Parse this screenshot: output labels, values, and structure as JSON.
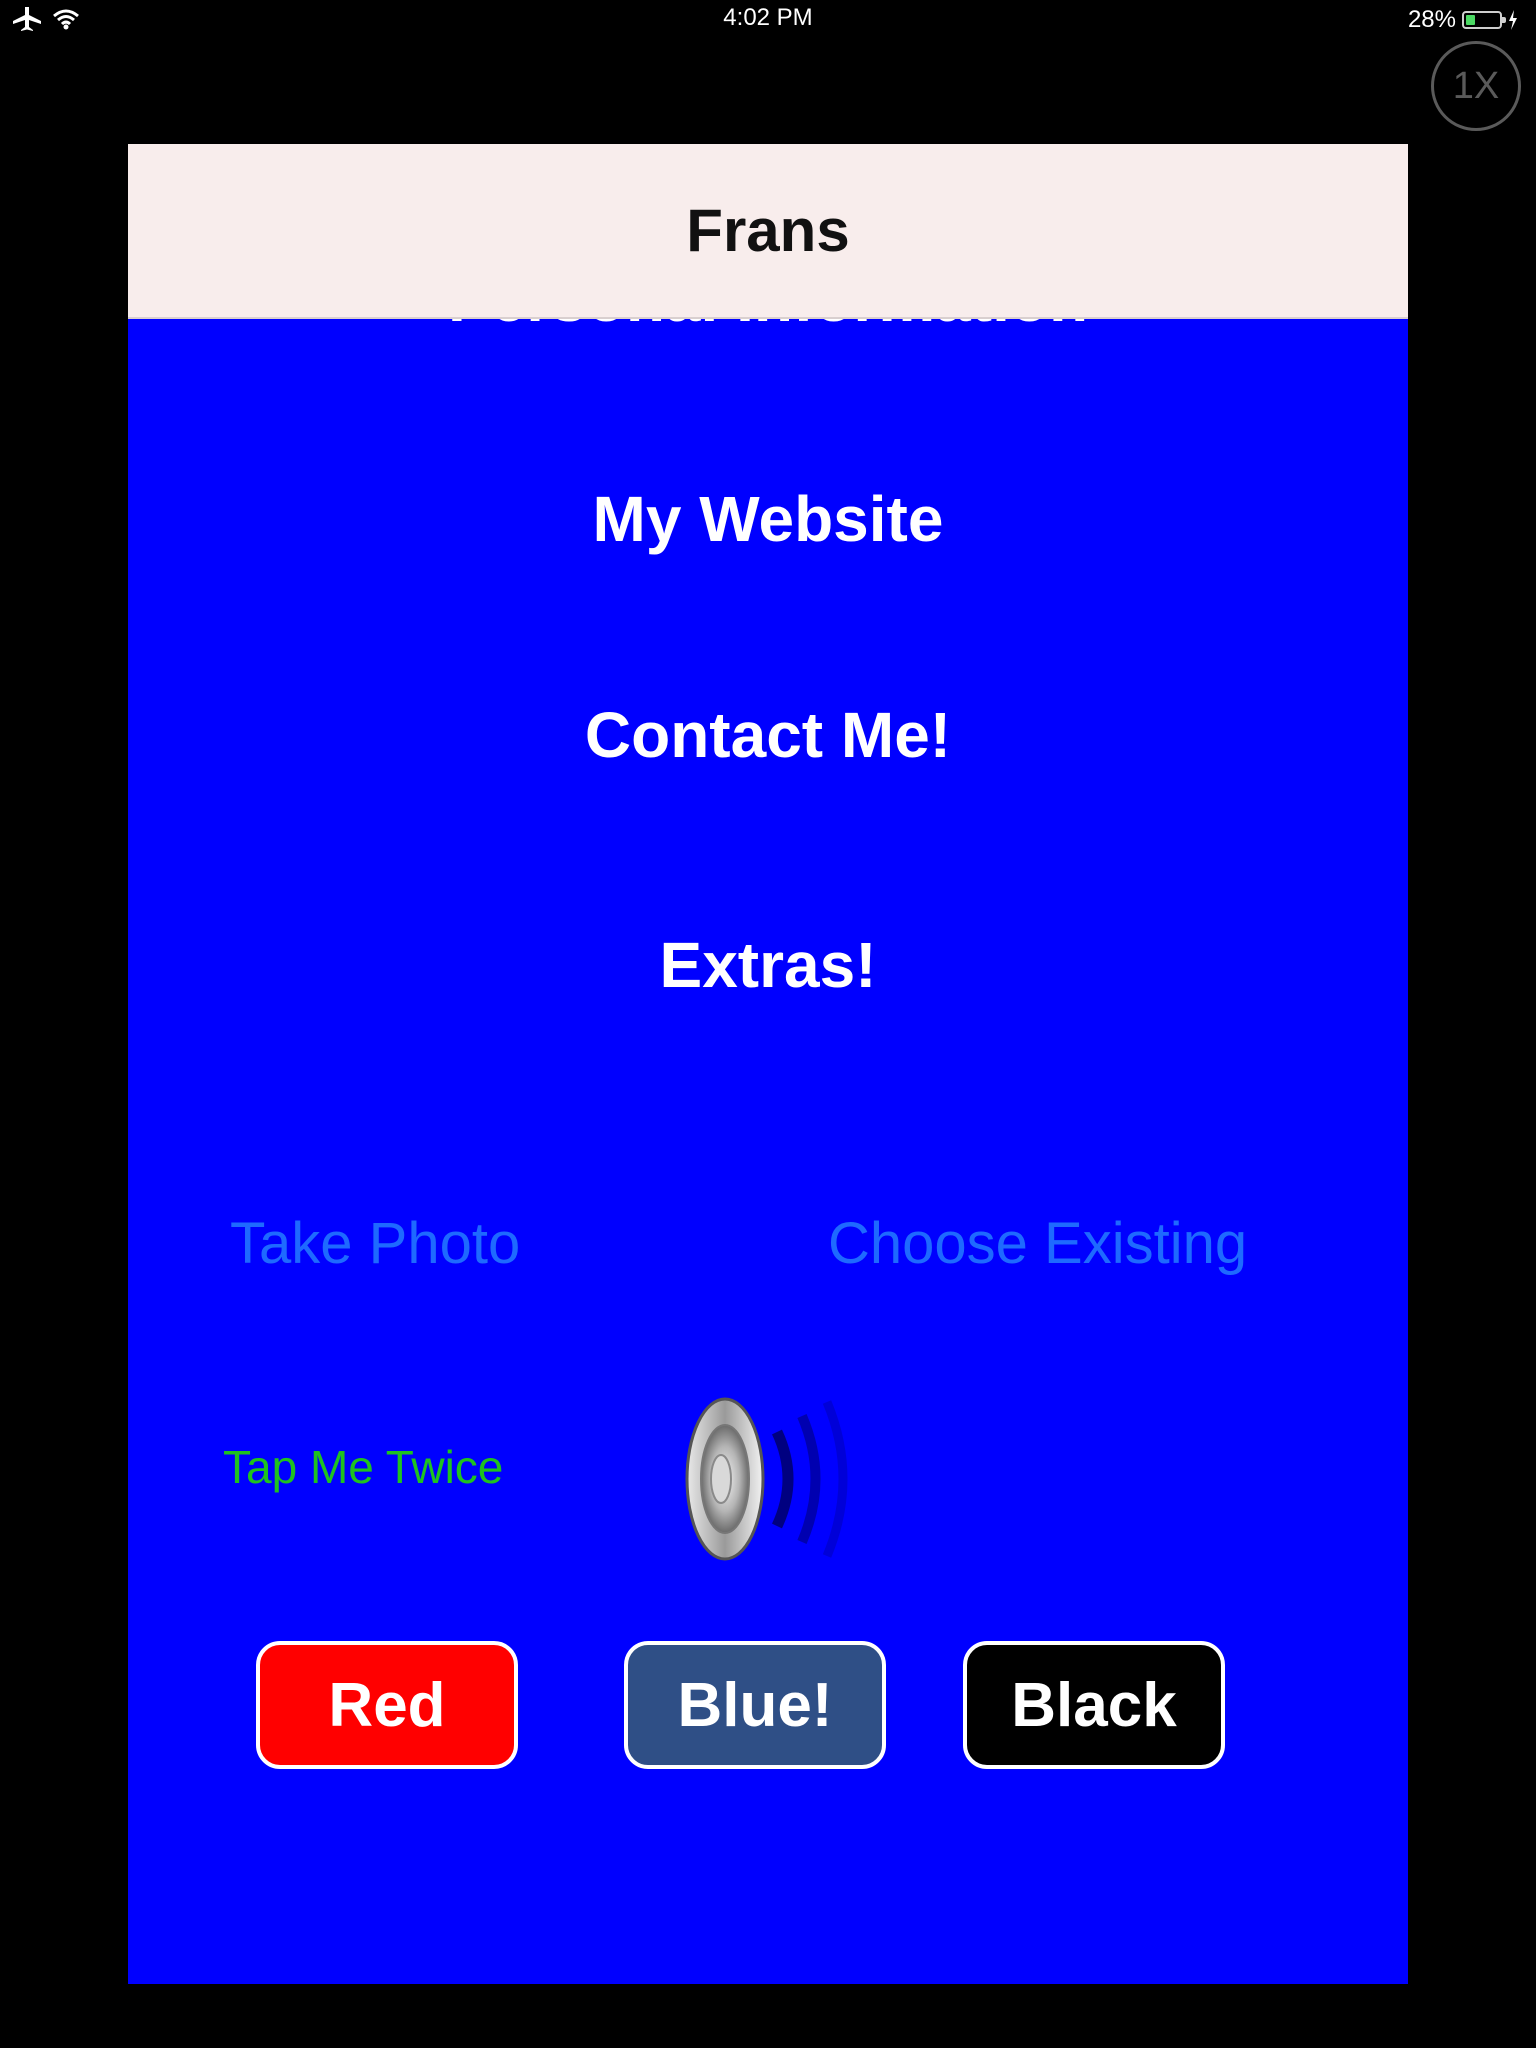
{
  "status_bar": {
    "time": "4:02 PM",
    "battery_percent": "28%",
    "battery_level": 0.28,
    "icons": [
      "airplane-icon",
      "wifi-icon",
      "charging-bolt-icon"
    ]
  },
  "zoom_badge": "1X",
  "nav": {
    "title": "Frans"
  },
  "menu": {
    "items": [
      {
        "label": "Personal Information"
      },
      {
        "label": "My Website"
      },
      {
        "label": "Contact Me!"
      },
      {
        "label": "Extras!"
      }
    ]
  },
  "photo": {
    "take_photo": "Take Photo",
    "choose_existing": "Choose Existing"
  },
  "tap_label": "Tap Me Twice",
  "speaker_icon": "speaker-icon",
  "color_buttons": [
    {
      "label": "Red",
      "color": "#ff0000"
    },
    {
      "label": "Blue!",
      "color": "#2f4f86"
    },
    {
      "label": "Black",
      "color": "#000000"
    }
  ],
  "colors": {
    "content_background": "#0000ff",
    "nav_background": "#f8edec",
    "link_color": "#1e6aff",
    "tap_color": "#1fc21f"
  }
}
